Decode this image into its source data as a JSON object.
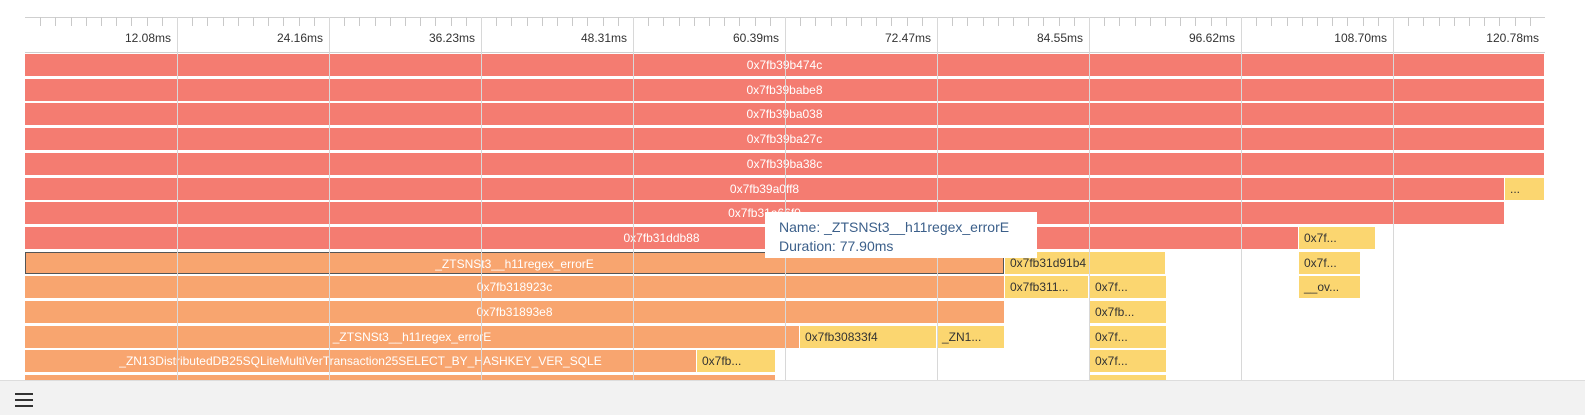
{
  "timeline": {
    "unit": "ms",
    "total_ms": 120.78,
    "ticks": [
      "12.08ms",
      "24.16ms",
      "36.23ms",
      "48.31ms",
      "60.39ms",
      "72.47ms",
      "84.55ms",
      "96.62ms",
      "108.70ms",
      "120.78ms"
    ]
  },
  "colors": {
    "red": "#f47c71",
    "orange": "#f8a56f",
    "yellow": "#fbd670"
  },
  "frames": [
    {
      "label": "0x7fb39b474c",
      "row": 0,
      "start": 0,
      "end": 120.78,
      "color": "red"
    },
    {
      "label": "0x7fb39babe8",
      "row": 1,
      "start": 0,
      "end": 120.78,
      "color": "red"
    },
    {
      "label": "0x7fb39ba038",
      "row": 2,
      "start": 0,
      "end": 120.78,
      "color": "red"
    },
    {
      "label": "0x7fb39ba27c",
      "row": 3,
      "start": 0,
      "end": 120.78,
      "color": "red"
    },
    {
      "label": "0x7fb39ba38c",
      "row": 4,
      "start": 0,
      "end": 120.78,
      "color": "red"
    },
    {
      "label": "0x7fb39a0ff8",
      "row": 5,
      "start": 0,
      "end": 117.6,
      "color": "red"
    },
    {
      "label": "...",
      "row": 5,
      "start": 117.6,
      "end": 120.78,
      "color": "yellow"
    },
    {
      "label": "0x7fb31a66f0",
      "row": 6,
      "start": 0,
      "end": 117.6,
      "color": "red"
    },
    {
      "label": "0x7fb31ddb88",
      "row": 7,
      "start": 0,
      "end": 101.2,
      "color": "red"
    },
    {
      "label": "0x7f...",
      "row": 7,
      "start": 101.2,
      "end": 106.1,
      "color": "yellow"
    },
    {
      "label": "",
      "row": 7,
      "start": 106.1,
      "end": 107.4,
      "color": "yellow"
    },
    {
      "label": "_ZTSNSt3__h11regex_errorE",
      "row": 8,
      "start": 0,
      "end": 77.9,
      "color": "orange",
      "selected": true
    },
    {
      "label": "0x7fb31d91b4",
      "row": 8,
      "start": 77.9,
      "end": 90.7,
      "color": "yellow"
    },
    {
      "label": "0x7f...",
      "row": 8,
      "start": 101.2,
      "end": 106.1,
      "color": "yellow"
    },
    {
      "label": "0x7fb318923c",
      "row": 9,
      "start": 0,
      "end": 77.9,
      "color": "orange"
    },
    {
      "label": "0x7fb311...",
      "row": 9,
      "start": 77.9,
      "end": 84.6,
      "color": "yellow"
    },
    {
      "label": "0x7f...",
      "row": 9,
      "start": 84.6,
      "end": 90.7,
      "color": "yellow"
    },
    {
      "label": "__ov...",
      "row": 9,
      "start": 101.2,
      "end": 106.1,
      "color": "yellow"
    },
    {
      "label": "0x7fb31893e8",
      "row": 10,
      "start": 0,
      "end": 77.9,
      "color": "orange"
    },
    {
      "label": "0x7fb...",
      "row": 10,
      "start": 84.6,
      "end": 90.7,
      "color": "yellow"
    },
    {
      "label": "_ZTSNSt3__h11regex_errorE",
      "row": 11,
      "start": 0,
      "end": 61.6,
      "color": "orange"
    },
    {
      "label": "0x7fb30833f4",
      "row": 11,
      "start": 61.6,
      "end": 72.5,
      "color": "yellow"
    },
    {
      "label": "_ZN1...",
      "row": 11,
      "start": 72.5,
      "end": 77.9,
      "color": "yellow"
    },
    {
      "label": "0x7f...",
      "row": 11,
      "start": 84.6,
      "end": 90.7,
      "color": "yellow"
    },
    {
      "label": "_ZN13DistributedDB25SQLiteMultiVerTransaction25SELECT_BY_HASHKEY_VER_SQLE",
      "row": 12,
      "start": 0,
      "end": 53.4,
      "color": "orange"
    },
    {
      "label": "0x7fb...",
      "row": 12,
      "start": 53.4,
      "end": 59.7,
      "color": "yellow"
    },
    {
      "label": "0x7f...",
      "row": 12,
      "start": 84.6,
      "end": 90.7,
      "color": "yellow"
    },
    {
      "label": "",
      "row": 13,
      "start": 0,
      "end": 59.7,
      "color": "orange"
    },
    {
      "label": "",
      "row": 13,
      "start": 84.6,
      "end": 90.7,
      "color": "yellow"
    }
  ],
  "tooltip": {
    "name_line": "Name: _ZTSNSt3__h11regex_errorE",
    "duration_line": "Duration: 77.90ms"
  },
  "bottom_bar": {
    "icon": "menu-icon"
  }
}
